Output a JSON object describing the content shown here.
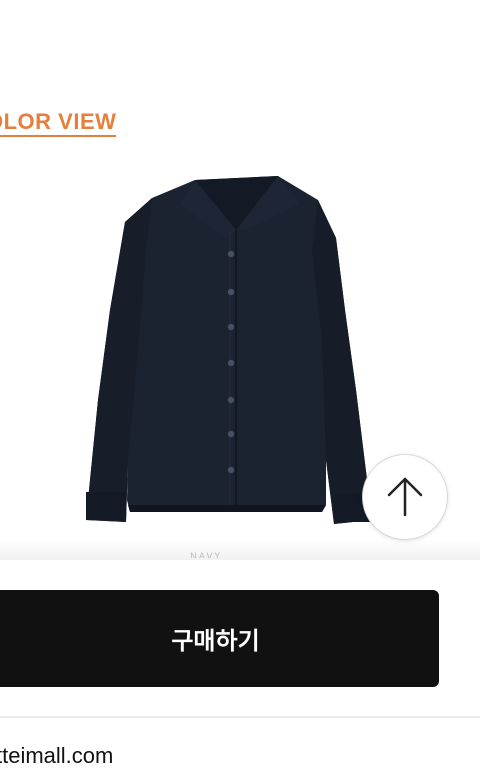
{
  "section": {
    "color_view_label": "OLOR VIEW",
    "accent_color": "#e57f3c"
  },
  "product": {
    "image_icon": "navy-shirt-image",
    "peek_label": "NAVY"
  },
  "scroll_top": {
    "icon": "arrow-up-icon"
  },
  "buy": {
    "label": "구매하기"
  },
  "footer": {
    "url": "tteimall.com"
  }
}
